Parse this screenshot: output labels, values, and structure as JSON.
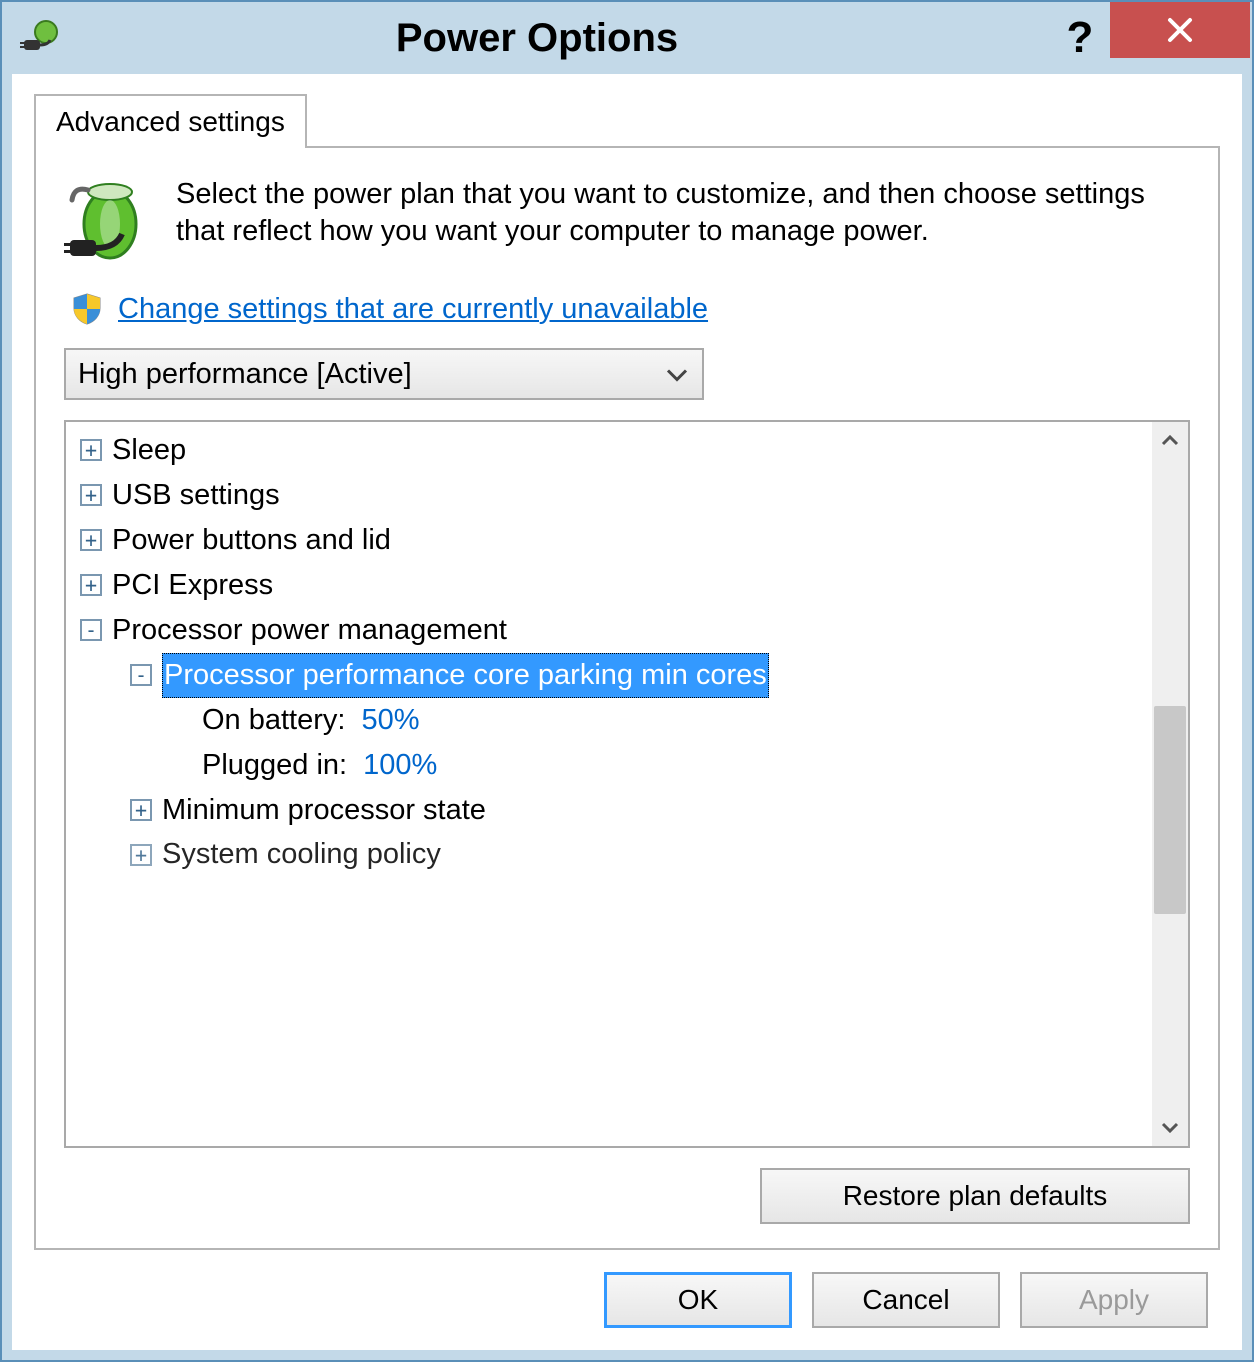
{
  "window": {
    "title": "Power Options"
  },
  "tab": {
    "label": "Advanced settings"
  },
  "intro": {
    "text": "Select the power plan that you want to customize, and then choose settings that reflect how you want your computer to manage power."
  },
  "uac": {
    "link_text": "Change settings that are currently unavailable"
  },
  "plan": {
    "selected": "High performance [Active]"
  },
  "tree": {
    "items": [
      {
        "label": "Sleep"
      },
      {
        "label": "USB settings"
      },
      {
        "label": "Power buttons and lid"
      },
      {
        "label": "PCI Express"
      }
    ],
    "ppm": {
      "label": "Processor power management",
      "core_parking": {
        "label": "Processor performance core parking min cores",
        "on_battery_label": "On battery:",
        "on_battery_value": "50%",
        "plugged_in_label": "Plugged in:",
        "plugged_in_value": "100%"
      },
      "min_state": {
        "label": "Minimum processor state"
      },
      "cooling": {
        "label": "System cooling policy"
      }
    }
  },
  "buttons": {
    "restore": "Restore plan defaults",
    "ok": "OK",
    "cancel": "Cancel",
    "apply": "Apply"
  }
}
